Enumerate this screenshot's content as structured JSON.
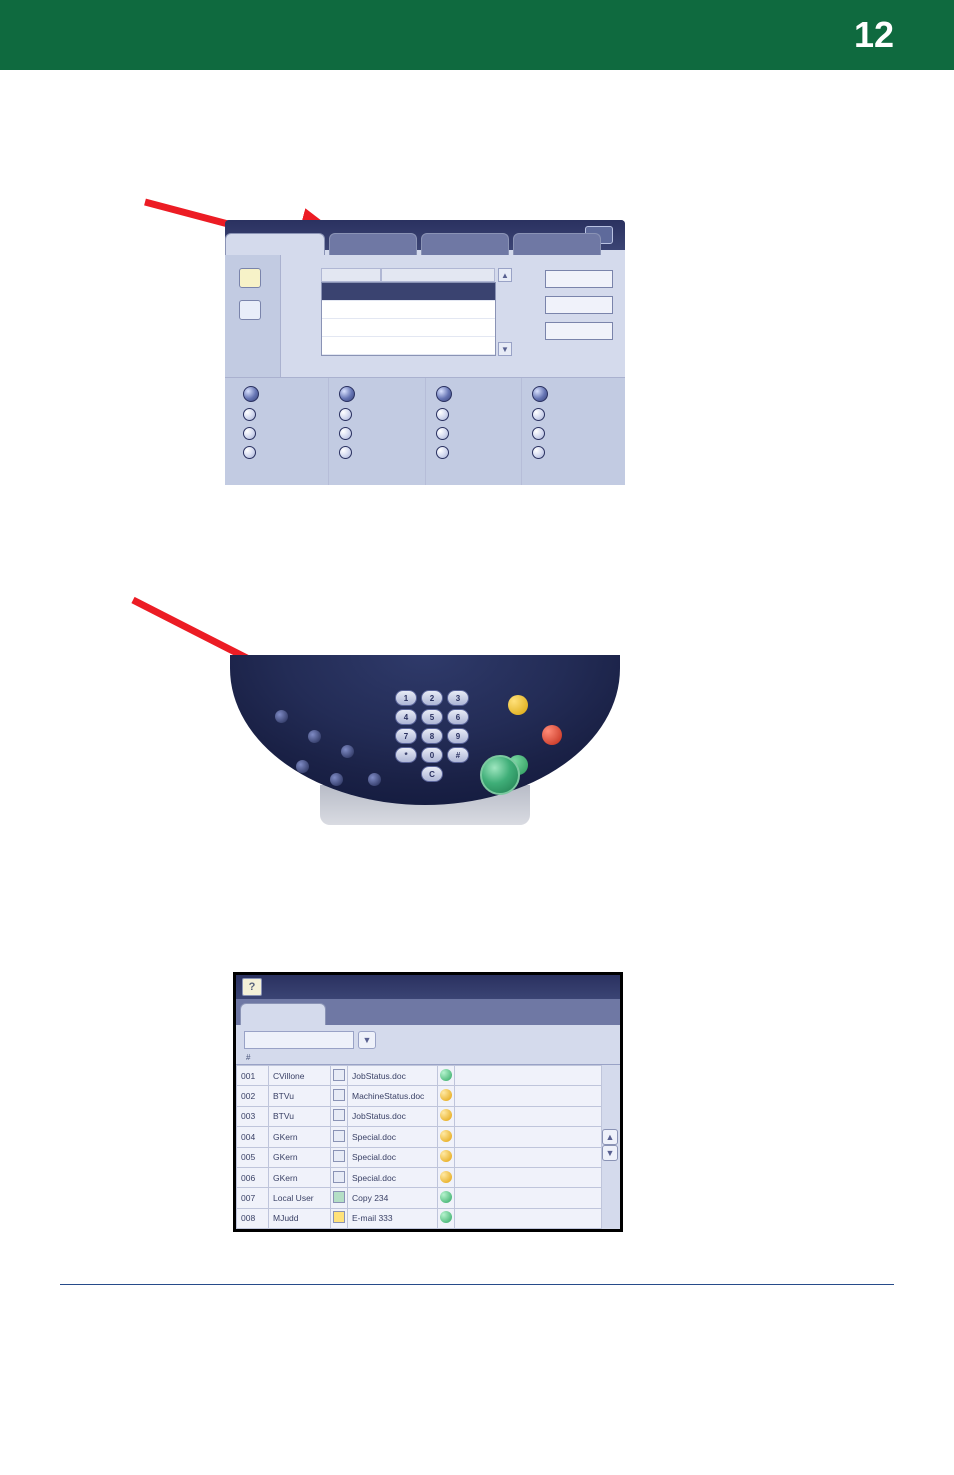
{
  "page": {
    "number": "12"
  },
  "fig3": {
    "subheader": "#",
    "rows": [
      {
        "num": "001",
        "user": "CVillone",
        "iconType": "doc",
        "doc": "JobStatus.doc",
        "status": "go"
      },
      {
        "num": "002",
        "user": "BTVu",
        "iconType": "doc",
        "doc": "MachineStatus.doc",
        "status": "warn"
      },
      {
        "num": "003",
        "user": "BTVu",
        "iconType": "doc",
        "doc": "JobStatus.doc",
        "status": "warn"
      },
      {
        "num": "004",
        "user": "GKern",
        "iconType": "doc",
        "doc": "Special.doc",
        "status": "warn"
      },
      {
        "num": "005",
        "user": "GKern",
        "iconType": "doc",
        "doc": "Special.doc",
        "status": "warn"
      },
      {
        "num": "006",
        "user": "GKern",
        "iconType": "doc",
        "doc": "Special.doc",
        "status": "warn"
      },
      {
        "num": "007",
        "user": "Local User",
        "iconType": "copy",
        "doc": "Copy 234",
        "status": "go"
      },
      {
        "num": "008",
        "user": "MJudd",
        "iconType": "mail",
        "doc": "E-mail 333",
        "status": "go"
      }
    ]
  },
  "keypad": [
    "1",
    "2",
    "3",
    "4",
    "5",
    "6",
    "7",
    "8",
    "9",
    "*",
    "0",
    "#",
    "",
    "C",
    ""
  ]
}
